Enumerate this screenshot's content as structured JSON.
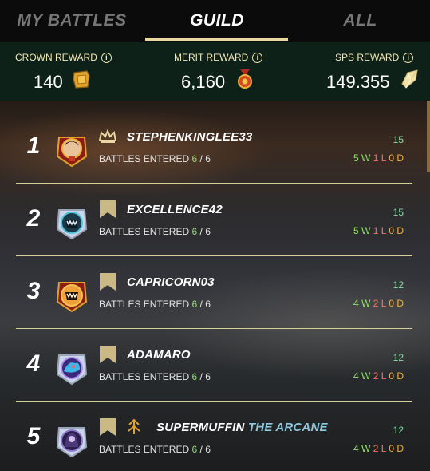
{
  "tabs": [
    {
      "label": "MY BATTLES",
      "active": false
    },
    {
      "label": "GUILD",
      "active": true
    },
    {
      "label": "ALL",
      "active": false
    }
  ],
  "rewards": [
    {
      "label": "CROWN REWARD",
      "value": "140",
      "icon": "crown-token-icon"
    },
    {
      "label": "MERIT REWARD",
      "value": "6,160",
      "icon": "merit-medal-icon"
    },
    {
      "label": "SPS REWARD",
      "value": "149.355",
      "icon": "sps-crystal-icon"
    }
  ],
  "info_glyph": "i",
  "battles_label": "BATTLES ENTERED",
  "separator": "/",
  "colors": {
    "accent": "#e7d9a0",
    "win": "#8ee06a",
    "loss": "#ff6f61",
    "draw": "#f0b13c",
    "score": "#8fd9a8",
    "guild_tag": "#8fc7dc"
  },
  "players": [
    {
      "rank": "1",
      "name": "STEPHENKINGLEE33",
      "guild_tag": "",
      "badge": "crown-icon",
      "entered": "6",
      "total": "6",
      "score": "15",
      "w": "5",
      "l": "1",
      "d": "0"
    },
    {
      "rank": "2",
      "name": "EXCELLENCE42",
      "guild_tag": "",
      "badge": "bookmark-icon",
      "entered": "6",
      "total": "6",
      "score": "15",
      "w": "5",
      "l": "1",
      "d": "0"
    },
    {
      "rank": "3",
      "name": "CAPRICORN03",
      "guild_tag": "",
      "badge": "bookmark-icon",
      "entered": "6",
      "total": "6",
      "score": "12",
      "w": "4",
      "l": "2",
      "d": "0"
    },
    {
      "rank": "4",
      "name": "ADAMARO",
      "guild_tag": "",
      "badge": "bookmark-icon",
      "entered": "6",
      "total": "6",
      "score": "12",
      "w": "4",
      "l": "2",
      "d": "0"
    },
    {
      "rank": "5",
      "name": "SUPERMUFFIN",
      "guild_tag": "THE ARCANE",
      "badge": "bookmark-icon",
      "entered": "6",
      "total": "6",
      "score": "12",
      "w": "4",
      "l": "2",
      "d": "0"
    }
  ]
}
